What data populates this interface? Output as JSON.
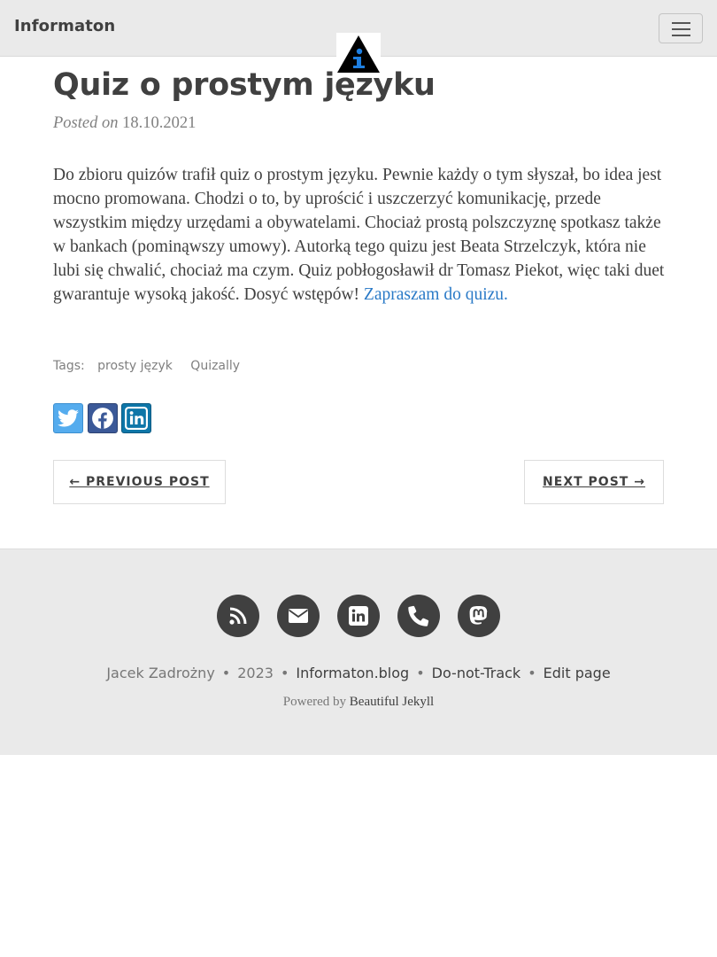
{
  "navbar": {
    "brand": "Informaton"
  },
  "post": {
    "title": "Quiz o prostym języku",
    "posted_prefix": "Posted on",
    "date": "18.10.2021",
    "body": "Do zbioru quizów trafił quiz o prostym języku. Pewnie każdy o tym słyszał, bo idea jest mocno promowana. Chodzi o to, by uprościć i uszczerzyć komunikację, przede wszystkim między urzędami a obywatelami. Chociaż prostą polszczyznę spotkasz także w bankach (pominąwszy umowy). Autorką tego quizu jest Beata Strzelczyk, która nie lubi się chwalić, chociaż ma czym. Quiz pobłogosławił dr Tomasz Piekot, więc taki duet gwarantuje wysoką jakość. Dosyć wstępów!",
    "link_text": "Zapraszam do quizu."
  },
  "tags": {
    "label": "Tags:",
    "items": [
      "prosty język",
      "Quizally"
    ]
  },
  "share": {
    "icons": [
      "twitter-icon",
      "facebook-icon",
      "linkedin-icon"
    ],
    "colors": {
      "twitter": "#55acee",
      "facebook": "#3b5998",
      "linkedin": "#0e76a8"
    }
  },
  "pager": {
    "prev": "← Previous Post",
    "next": "Next Post →"
  },
  "footer": {
    "social_icons": [
      "rss-icon",
      "envelope-icon",
      "linkedin-icon",
      "phone-icon",
      "mastodon-icon"
    ],
    "author": "Jacek Zadrożny",
    "year": "2023",
    "site": "Informaton.blog",
    "dnt": "Do-not-Track",
    "edit": "Edit page",
    "powered_prefix": "Powered by",
    "powered_link": "Beautiful Jekyll",
    "separator": "•"
  },
  "colors": {
    "navbar_bg": "#eaeaea",
    "link": "#2a7ac7",
    "text": "#404040",
    "logo_blue": "#1e7fe0"
  }
}
